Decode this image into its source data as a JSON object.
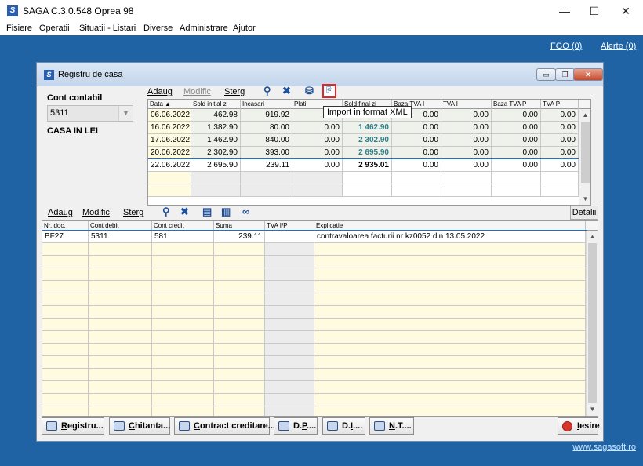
{
  "app": {
    "title": "SAGA C.3.0.548  Oprea 98",
    "icon": "saga-logo-icon",
    "window_controls": {
      "minimize": "—",
      "maximize": "☐",
      "close": "✕"
    }
  },
  "menu": [
    "Fisiere",
    "Operatii",
    "Situatii - Listari",
    "Diverse",
    "Administrare",
    "Ajutor"
  ],
  "top_links": {
    "fgo": "FGO (0)",
    "alerte": "Alerte (0)"
  },
  "site_link": "www.sagasoft.ro",
  "window": {
    "title": "Registru de casa",
    "controls": {
      "minimize": "▭",
      "restore": "❐",
      "close": "✕"
    }
  },
  "left_pane": {
    "cont_label": "Cont contabil",
    "cont_value": "5311",
    "cont_name": "CASA IN LEI"
  },
  "toolbar1": {
    "adaug": "Adaug",
    "modific": "Modific",
    "sterg": "Sterg",
    "tooltip": "Import in format XML"
  },
  "grid1": {
    "columns": [
      "Data ▲",
      "Sold initial zi",
      "Incasari",
      "Plati",
      "Sold final zi",
      "Baza TVA I",
      "TVA I",
      "Baza TVA P",
      "TVA P"
    ],
    "rows": [
      [
        "06.06.2022",
        "462.98",
        "919.92",
        "",
        "",
        "0.00",
        "0.00",
        "0.00",
        "0.00"
      ],
      [
        "16.06.2022",
        "1 382.90",
        "80.00",
        "0.00",
        "1 462.90",
        "0.00",
        "0.00",
        "0.00",
        "0.00"
      ],
      [
        "17.06.2022",
        "1 462.90",
        "840.00",
        "0.00",
        "2 302.90",
        "0.00",
        "0.00",
        "0.00",
        "0.00"
      ],
      [
        "20.06.2022",
        "2 302.90",
        "393.00",
        "0.00",
        "2 695.90",
        "0.00",
        "0.00",
        "0.00",
        "0.00"
      ],
      [
        "22.06.2022",
        "2 695.90",
        "239.11",
        "0.00",
        "2 935.01",
        "0.00",
        "0.00",
        "0.00",
        "0.00"
      ]
    ]
  },
  "toolbar2": {
    "adaug": "Adaug",
    "modific": "Modific",
    "sterg": "Sterg",
    "detalii": "Detalii"
  },
  "grid2": {
    "columns": [
      "Nr. doc.",
      "Cont debit",
      "Cont credit",
      "Suma",
      "TVA I/P",
      "Explicatie"
    ],
    "rows": [
      [
        "BF27",
        "5311",
        "581",
        "239.11",
        "",
        "contravaloarea facturii nr kz0052 din 13.05.2022"
      ]
    ]
  },
  "bottom_buttons": [
    {
      "pre": "",
      "u": "R",
      "post": "egistru..."
    },
    {
      "pre": "",
      "u": "C",
      "post": "hitanta..."
    },
    {
      "pre": "",
      "u": "C",
      "post": "ontract creditare..."
    },
    {
      "pre": "D.",
      "u": "P",
      "post": "...."
    },
    {
      "pre": "D.",
      "u": "I",
      "post": "...."
    },
    {
      "pre": "",
      "u": "N",
      "post": ".T...."
    }
  ],
  "exit_button": {
    "pre": "",
    "u": "I",
    "post": "esire"
  }
}
